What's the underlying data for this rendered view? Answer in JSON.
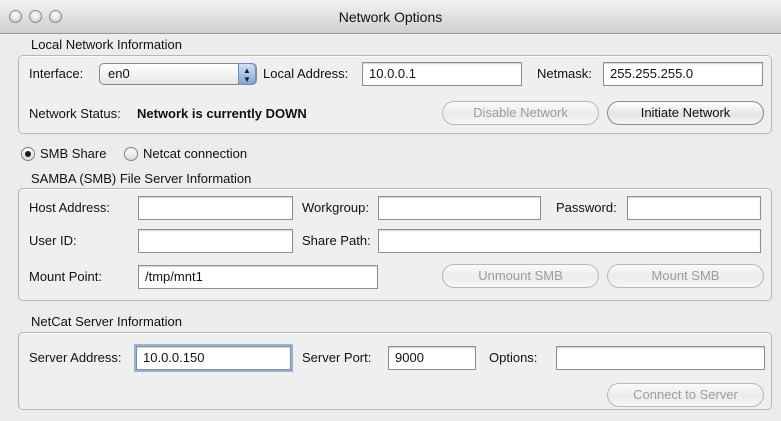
{
  "window": {
    "title": "Network Options"
  },
  "local_network": {
    "group_title": "Local Network Information",
    "interface_label": "Interface:",
    "interface_value": "en0",
    "local_address_label": "Local Address:",
    "local_address_value": "10.0.0.1",
    "netmask_label": "Netmask:",
    "netmask_value": "255.255.255.0",
    "status_label": "Network Status:",
    "status_value": "Network is currently DOWN",
    "disable_button": "Disable Network",
    "initiate_button": "Initiate Network"
  },
  "mode": {
    "smb_label": "SMB Share",
    "netcat_label": "Netcat connection",
    "selected": "SMB Share"
  },
  "smb": {
    "group_title": "SAMBA (SMB) File Server Information",
    "host_label": "Host Address:",
    "host_value": "",
    "workgroup_label": "Workgroup:",
    "workgroup_value": "",
    "password_label": "Password:",
    "password_value": "",
    "userid_label": "User ID:",
    "userid_value": "",
    "sharepath_label": "Share Path:",
    "sharepath_value": "",
    "mountpoint_label": "Mount Point:",
    "mountpoint_value": "/tmp/mnt1",
    "unmount_button": "Unmount SMB",
    "mount_button": "Mount SMB"
  },
  "netcat": {
    "group_title": "NetCat Server Information",
    "server_address_label": "Server Address:",
    "server_address_value": "10.0.0.150",
    "server_port_label": "Server Port:",
    "server_port_value": "9000",
    "options_label": "Options:",
    "options_value": "",
    "connect_button": "Connect to Server"
  }
}
